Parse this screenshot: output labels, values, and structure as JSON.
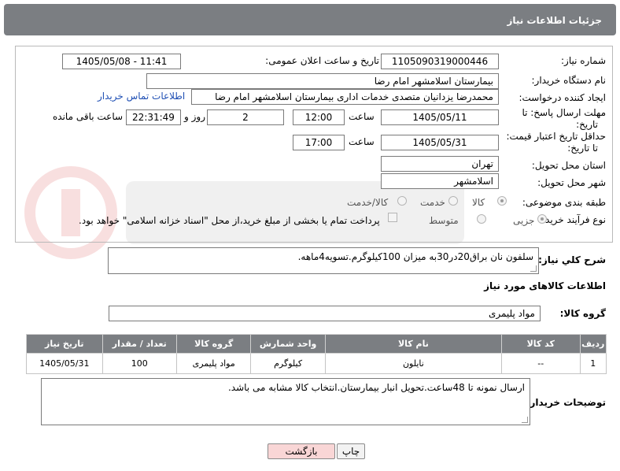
{
  "header": {
    "title": "جزئیات اطلاعات نیاز"
  },
  "form": {
    "need_number_label": "شماره نیاز:",
    "need_number": "1105090319000446",
    "announce_label": "تاریخ و ساعت اعلان عمومی:",
    "announce_value": "1405/05/08 - 11:41",
    "buyer_org_label": "نام دستگاه خریدار:",
    "buyer_org": "بیمارستان اسلامشهر   امام رضا",
    "creator_label": "ایجاد کننده درخواست:",
    "creator": "محمدرضا یزدانیان متصدی خدمات اداری بیمارستان اسلامشهر   امام رضا",
    "contact_link": "اطلاعات تماس خریدار",
    "deadline_label_1": "مهلت ارسال پاسخ: تا",
    "deadline_label_2": "تاریخ:",
    "deadline_date": "1405/05/11",
    "time_label": "ساعت",
    "deadline_time": "12:00",
    "days_value": "2",
    "days_label": "روز و",
    "remaining_time": "22:31:49",
    "remaining_label": "ساعت باقی مانده",
    "price_label_1": "حداقل تاریخ اعتبار قیمت:",
    "price_label_2": "تا تاریخ:",
    "price_date": "1405/05/31",
    "price_time": "17:00",
    "province_label": "استان محل تحویل:",
    "province": "تهران",
    "city_label": "شهر محل تحویل:",
    "city": "اسلامشهر",
    "category_label": "طبقه بندی موضوعی:",
    "category_options": [
      "کالا",
      "خدمت",
      "کالا/خدمت"
    ],
    "process_label": "نوع فرآیند خرید :",
    "process_options": [
      "جزیی",
      "متوسط"
    ],
    "payment_note": "پرداخت تمام یا بخشی از مبلغ خرید،از محل \"اسناد خزانه اسلامی\" خواهد بود."
  },
  "description": {
    "label": "شرح کلي نياز:",
    "text": "سلفون نان براق20در30به میزان 100کیلوگرم.تسویه4ماهه."
  },
  "goods": {
    "section_title": "اطلاعات کالاهای مورد نیاز",
    "group_label": "گروه کالا:",
    "group_value": "مواد پلیمری",
    "columns": [
      "ردیف",
      "کد کالا",
      "نام کالا",
      "واحد شمارش",
      "گروه کالا",
      "تعداد / مقدار",
      "تاریخ نیاز"
    ],
    "rows": [
      {
        "row": "1",
        "code": "--",
        "name": "نایلون",
        "unit": "کیلوگرم",
        "group": "مواد پلیمری",
        "qty": "100",
        "date": "1405/05/31"
      }
    ]
  },
  "buyer_notes": {
    "label": "توضیحات خریدار:",
    "text": "ارسال نمونه تا 48ساعت.تحویل انبار بیمارستان.انتخاب کالا مشابه می باشد."
  },
  "buttons": {
    "print": "چاپ",
    "back": "بازگشت"
  },
  "colors": {
    "header_bg": "#7b7e82",
    "link": "#1f4fb4",
    "back_bg": "#f9d6d6"
  }
}
